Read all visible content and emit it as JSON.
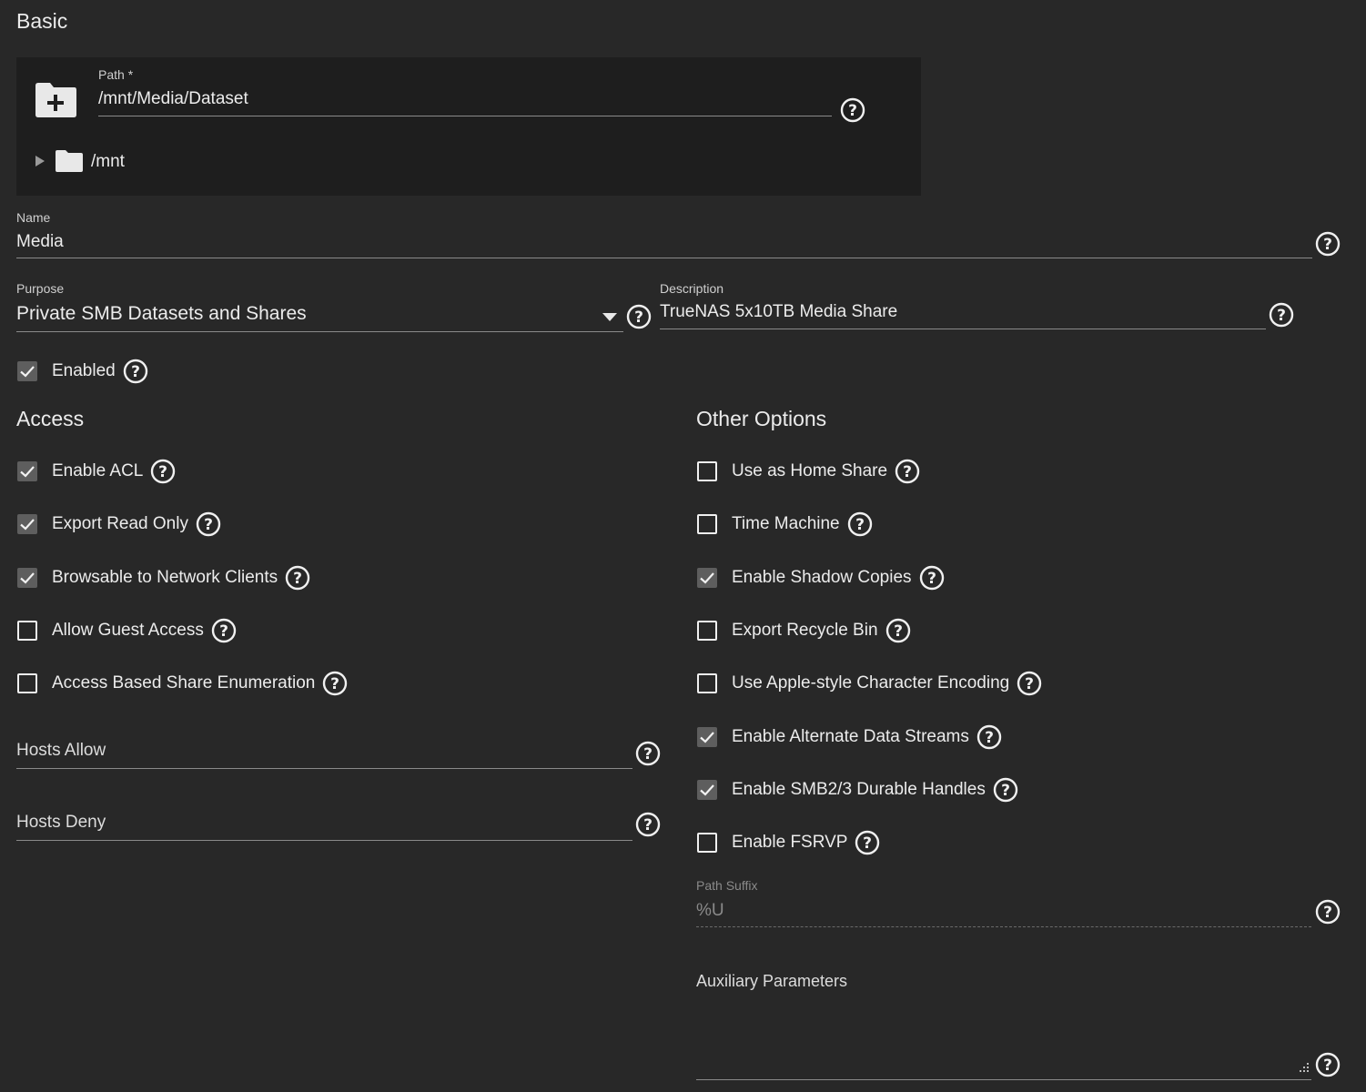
{
  "basic": {
    "title": "Basic",
    "path_label": "Path *",
    "path_value": "/mnt/Media/Dataset",
    "tree_root": "/mnt",
    "name_label": "Name",
    "name_value": "Media",
    "purpose_label": "Purpose",
    "purpose_value": "Private SMB Datasets and Shares",
    "description_label": "Description",
    "description_value": "TrueNAS 5x10TB Media Share",
    "enabled_label": "Enabled",
    "enabled_checked": true
  },
  "access": {
    "title": "Access",
    "options": [
      {
        "label": "Enable ACL",
        "checked": true
      },
      {
        "label": "Export Read Only",
        "checked": true
      },
      {
        "label": "Browsable to Network Clients",
        "checked": true
      },
      {
        "label": "Allow Guest Access",
        "checked": false
      },
      {
        "label": "Access Based Share Enumeration",
        "checked": false
      }
    ],
    "hosts_allow_placeholder": "Hosts Allow",
    "hosts_deny_placeholder": "Hosts Deny"
  },
  "other": {
    "title": "Other Options",
    "options": [
      {
        "label": "Use as Home Share",
        "checked": false
      },
      {
        "label": "Time Machine",
        "checked": false
      },
      {
        "label": "Enable Shadow Copies",
        "checked": true
      },
      {
        "label": "Export Recycle Bin",
        "checked": false
      },
      {
        "label": "Use Apple-style Character Encoding",
        "checked": false
      },
      {
        "label": "Enable Alternate Data Streams",
        "checked": true
      },
      {
        "label": "Enable SMB2/3 Durable Handles",
        "checked": true
      },
      {
        "label": "Enable FSRVP",
        "checked": false
      }
    ],
    "path_suffix_label": "Path Suffix",
    "path_suffix_value": "%U",
    "aux_params_label": "Auxiliary Parameters"
  },
  "colors": {
    "background": "#282828",
    "panel": "#1e1e1e",
    "checkbox_on": "#5e5e5e",
    "text": "#ececec"
  }
}
